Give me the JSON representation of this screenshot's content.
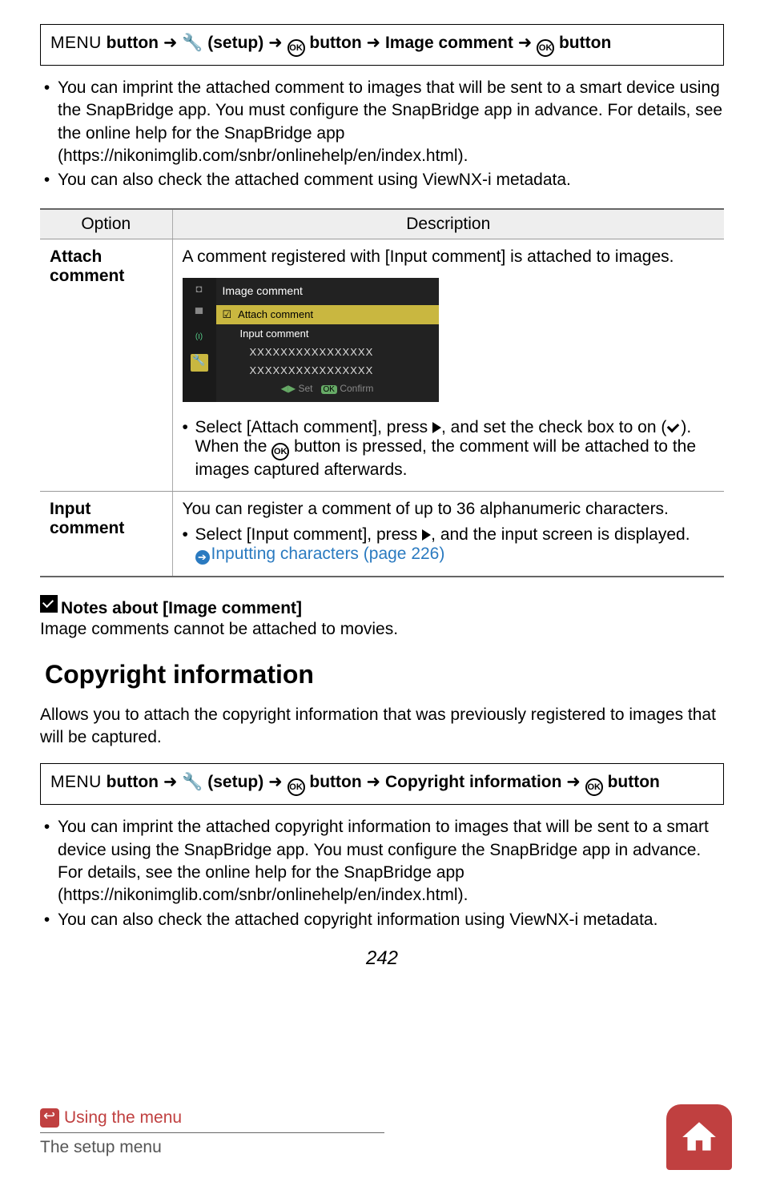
{
  "nav1": {
    "prefix": "MENU",
    "text1": " button ",
    "arrow": "➜",
    "setup": " (setup) ",
    "button_word": " button ",
    "target": " Image comment ",
    "end": " button"
  },
  "bullets1": {
    "item1": "You can imprint the attached comment to images that will be sent to a smart device using the SnapBridge app. You must configure the SnapBridge app in advance. For details, see the online help for the SnapBridge app (https://nikonimglib.com/snbr/onlinehelp/en/index.html).",
    "item2": "You can also check the attached comment using ViewNX-i metadata."
  },
  "table": {
    "head_option": "Option",
    "head_desc": "Description",
    "row1_label": "Attach comment",
    "row1_intro_a": "A comment registered with [",
    "row1_intro_bold": "Input comment",
    "row1_intro_b": "] is attached to images.",
    "row1_bullet_a": "Select [",
    "row1_bullet_bold": "Attach comment",
    "row1_bullet_b": "], press ",
    "row1_bullet_c": ", and set the check box to on (",
    "row1_bullet_d": "). When the ",
    "row1_bullet_e": " button is pressed, the comment will be attached to the images captured afterwards.",
    "row2_label": "Input comment",
    "row2_intro": "You can register a comment of up to 36 alphanumeric characters.",
    "row2_bullet_a": "Select [",
    "row2_bullet_bold": "Input comment",
    "row2_bullet_b": "], press ",
    "row2_bullet_c": ", and the input screen is displayed.",
    "row2_link": "Inputting characters (page 226)"
  },
  "shot": {
    "title": "Image comment",
    "row_attach": "Attach comment",
    "row_input": "Input comment",
    "xxx1": "XXXXXXXXXXXXXXXX",
    "xxx2": "XXXXXXXXXXXXXXXX",
    "footer_set": "Set",
    "footer_confirm": "Confirm"
  },
  "notes": {
    "title": "Notes about [Image comment]",
    "body": "Image comments cannot be attached to movies."
  },
  "section_title": "Copyright information",
  "section_para": "Allows you to attach the copyright information that was previously registered to images that will be captured.",
  "nav2": {
    "target": " Copyright information ",
    "end": "button"
  },
  "bullets2": {
    "item1": "You can imprint the attached copyright information to images that will be sent to a smart device using the SnapBridge app. You must configure the SnapBridge app in advance. For details, see the online help for the SnapBridge app (https://nikonimglib.com/snbr/onlinehelp/en/index.html).",
    "item2": "You can also check the attached copyright information using ViewNX-i metadata."
  },
  "page_number": "242",
  "footer": {
    "menu_link": "Using the menu",
    "sub": "The setup menu"
  },
  "ok_label": "OK",
  "wrench_glyph": "🔧",
  "camera_glyph": "📷",
  "video_glyph": "🎥",
  "net_glyph": "📶"
}
